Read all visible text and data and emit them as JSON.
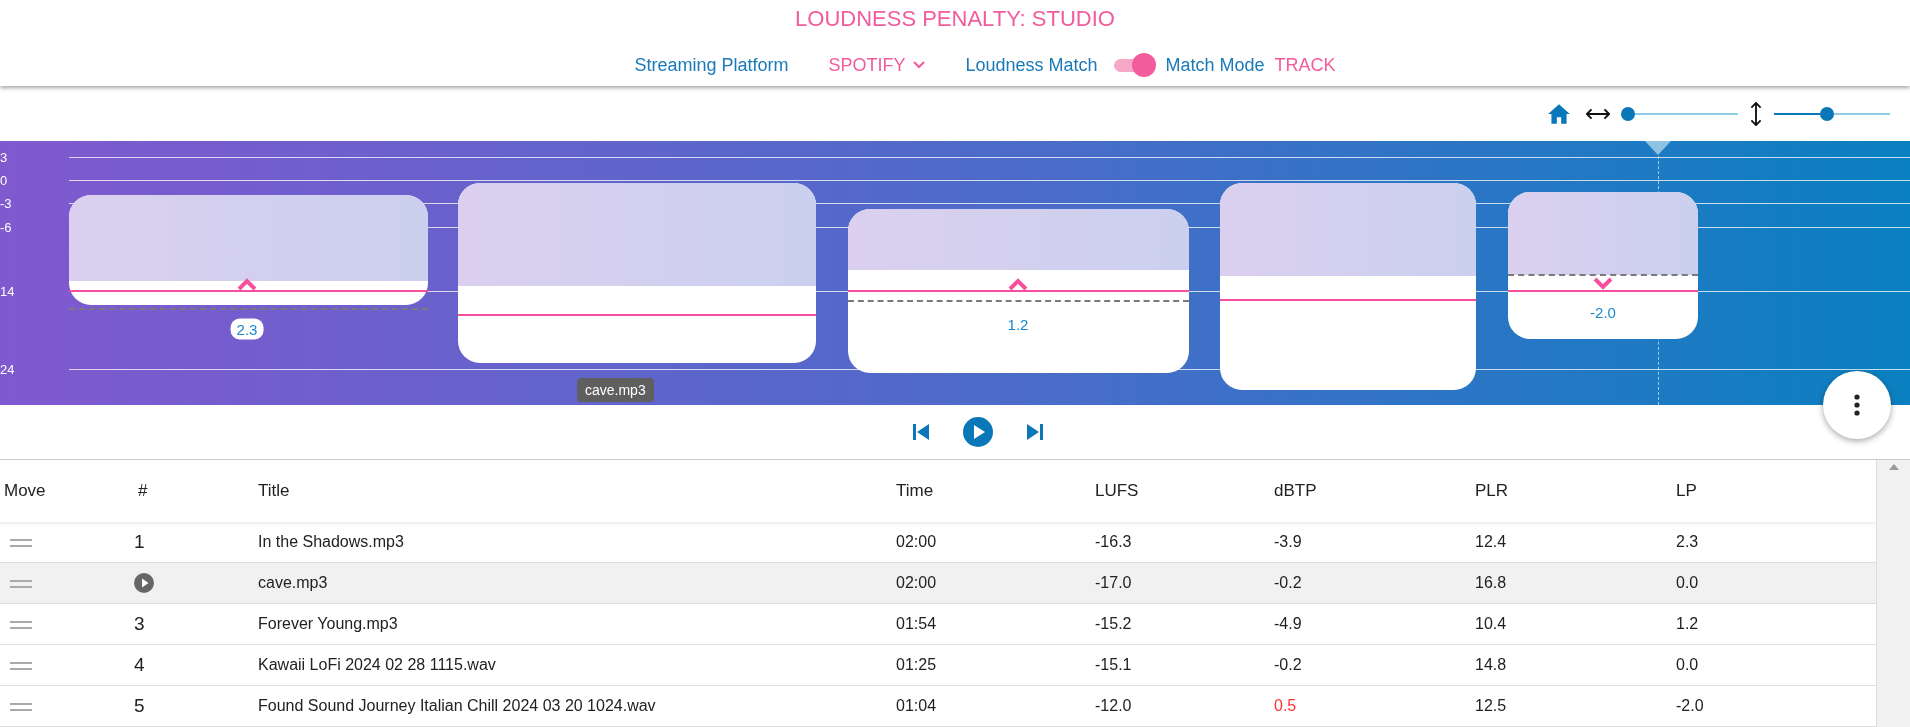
{
  "header": {
    "title": "LOUDNESS PENALTY: STUDIO",
    "platform_label": "Streaming Platform",
    "platform_value": "SPOTIFY",
    "loudness_match": {
      "label": "Loudness Match",
      "on": true
    },
    "match_mode": {
      "label": "Match Mode",
      "value": "TRACK"
    }
  },
  "zoom": {
    "horizontal": {
      "level": 0.05
    },
    "vertical": {
      "level": 0.46
    }
  },
  "loudness_view": {
    "axis_labels": [
      "3",
      "0",
      "-3",
      "-6",
      "14",
      "24"
    ],
    "blocks": [
      {
        "kind": "up",
        "label": "2.3"
      },
      {
        "kind": "none",
        "tooltip": "cave.mp3"
      },
      {
        "kind": "up",
        "label": "1.2"
      },
      {
        "kind": "none"
      },
      {
        "kind": "down",
        "label": "-2.0"
      }
    ]
  },
  "table": {
    "columns": [
      "Move",
      "#",
      "Title",
      "Time",
      "LUFS",
      "dBTP",
      "PLR",
      "LP"
    ],
    "rows": [
      {
        "number": "1",
        "title": "In the Shadows.mp3",
        "time": "02:00",
        "lufs": "-16.3",
        "dbtp": "-3.9",
        "plr": "12.4",
        "lp": "2.3",
        "playing": false,
        "clipping": false
      },
      {
        "title": "cave.mp3",
        "time": "02:00",
        "lufs": "-17.0",
        "dbtp": "-0.2",
        "plr": "16.8",
        "lp": "0.0",
        "playing": true,
        "clipping": false
      },
      {
        "number": "3",
        "title": "Forever Young.mp3",
        "time": "01:54",
        "lufs": "-15.2",
        "dbtp": "-4.9",
        "plr": "10.4",
        "lp": "1.2",
        "playing": false,
        "clipping": false
      },
      {
        "number": "4",
        "title": "Kawaii LoFi 2024 02 28 1115.wav",
        "time": "01:25",
        "lufs": "-15.1",
        "dbtp": "-0.2",
        "plr": "14.8",
        "lp": "0.0",
        "playing": false,
        "clipping": false
      },
      {
        "number": "5",
        "title": "Found Sound Journey Italian Chill 2024 03 20 1024.wav",
        "time": "01:04",
        "lufs": "-12.0",
        "dbtp": "0.5",
        "plr": "12.5",
        "lp": "-2.0",
        "playing": false,
        "clipping": true
      }
    ]
  }
}
